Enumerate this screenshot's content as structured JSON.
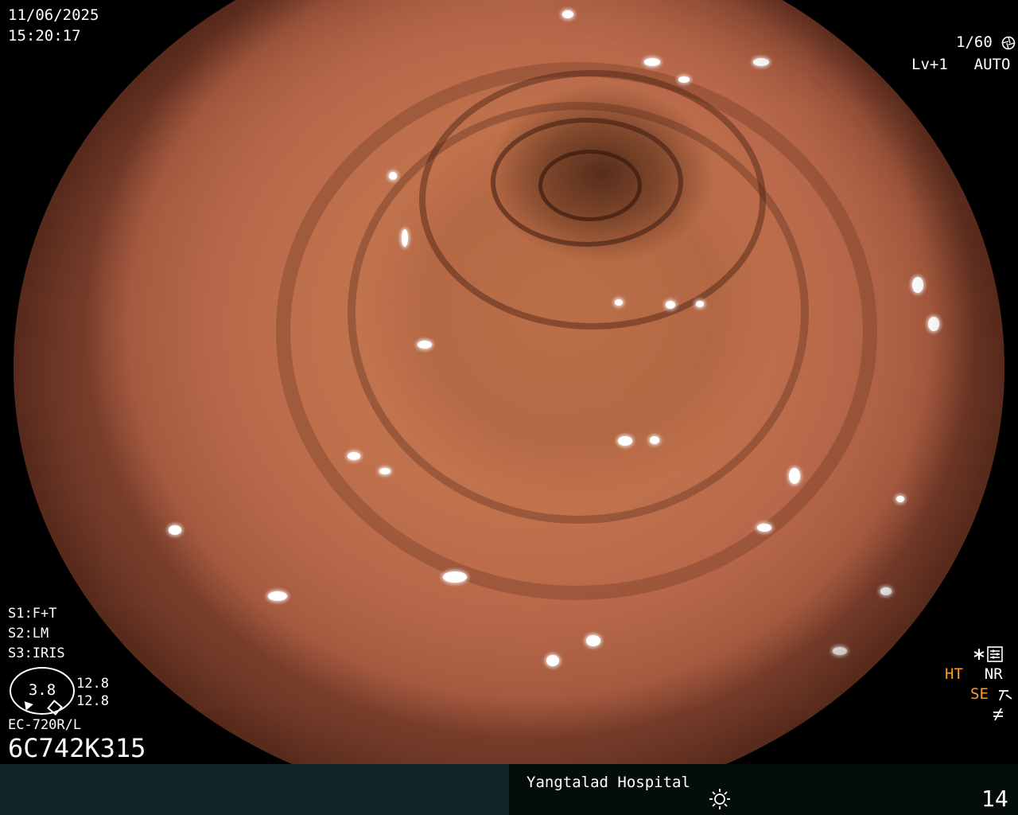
{
  "overlay": {
    "date": "11/06/2025",
    "time": "15:20:17",
    "shutter": "1/60",
    "level": "Lv+1",
    "auto_label": "AUTO",
    "s1": "S1:F+T",
    "s2": "S2:LM",
    "s3": "S3:IRIS",
    "iris_value": "3.8",
    "iris_upper": "12.8",
    "iris_lower": "12.8",
    "scope_model": "EC-720R/L",
    "scope_serial": "6C742K315",
    "mode_ht": "HT",
    "mode_nr": "NR",
    "mode_se": "SE",
    "hospital": "Yangtalad Hospital",
    "frame_number": "14"
  },
  "icons": {
    "shutter": "aperture-icon",
    "auto": "camera-lens-icon",
    "settings": "asterisk-settings-icon",
    "se": "enhancement-icon",
    "unlink": "unlink-icon",
    "light": "sun-icon"
  },
  "colors": {
    "overlay_text": "#ffffff",
    "mode_highlight": "#ff9a2e",
    "bottom_bar": "#0f2424"
  }
}
